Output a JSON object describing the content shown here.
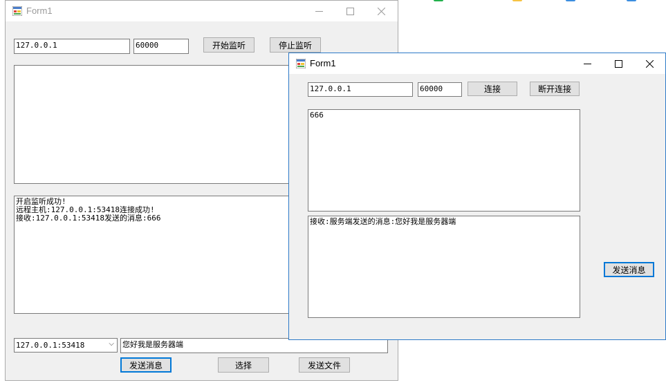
{
  "server": {
    "title": "Form1",
    "ip": "127.0.0.1",
    "port": "60000",
    "start_label": "开始监听",
    "stop_label": "停止监听",
    "log": "开启监听成功!\n远程主机:127.0.0.1:53418连接成功!\n接收:127.0.0.1:53418发送的消息:666",
    "client_select": "127.0.0.1:53418",
    "message": "您好我是服务器端",
    "send_label": "发送消息",
    "choose_label": "选择",
    "send_file_label": "发送文件"
  },
  "client": {
    "title": "Form1",
    "ip": "127.0.0.1",
    "port": "60000",
    "connect_label": "连接",
    "disconnect_label": "断开连接",
    "input_text": "666",
    "received": "接收:服务端发送的消息:您好我是服务器端",
    "send_label": "发送消息"
  },
  "icons": {
    "minimize": "minimize-icon",
    "maximize": "maximize-icon",
    "close": "close-icon",
    "app": "form-app-icon"
  },
  "colors": {
    "focus_border": "#0078d7",
    "window_bg": "#f0f0f0",
    "active_window_border": "#2b79c8"
  }
}
